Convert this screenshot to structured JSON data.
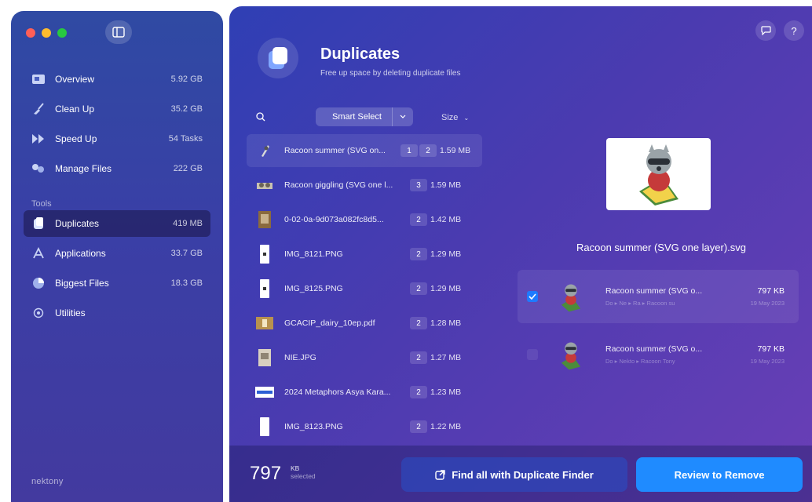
{
  "sidebar": {
    "items": [
      {
        "label": "Overview",
        "size": "5.92 GB",
        "icon": "overview-icon"
      },
      {
        "label": "Clean Up",
        "size": "35.2 GB",
        "icon": "broom-icon"
      },
      {
        "label": "Speed Up",
        "size": "54 Tasks",
        "icon": "speed-icon"
      },
      {
        "label": "Manage Files",
        "size": "222 GB",
        "icon": "files-icon"
      }
    ],
    "tools_heading": "Tools",
    "tools": [
      {
        "label": "Duplicates",
        "size": "419 MB",
        "icon": "duplicates-icon",
        "active": true
      },
      {
        "label": "Applications",
        "size": "33.7 GB",
        "icon": "applications-icon"
      },
      {
        "label": "Biggest Files",
        "size": "18.3 GB",
        "icon": "pie-icon"
      },
      {
        "label": "Utilities",
        "size": "",
        "icon": "utilities-icon"
      }
    ],
    "brand": "nektony"
  },
  "header": {
    "title": "Duplicates",
    "subtitle": "Free up space by deleting duplicate files"
  },
  "toolbar": {
    "smart_select": "Smart Select",
    "size_sort": "Size"
  },
  "files": [
    {
      "name": "Racoon summer (SVG on...",
      "badges": [
        "1",
        "2"
      ],
      "size": "1.59 MB",
      "selected": true
    },
    {
      "name": "Racoon giggling (SVG one l...",
      "badges": [
        "3"
      ],
      "size": "1.59 MB"
    },
    {
      "name": "0-02-0a-9d073a082fc8d5...",
      "badges": [
        "2"
      ],
      "size": "1.42 MB"
    },
    {
      "name": "IMG_8121.PNG",
      "badges": [
        "2"
      ],
      "size": "1.29 MB"
    },
    {
      "name": "IMG_8125.PNG",
      "badges": [
        "2"
      ],
      "size": "1.29 MB"
    },
    {
      "name": "GCACIP_dairy_10ep.pdf",
      "badges": [
        "2"
      ],
      "size": "1.28 MB"
    },
    {
      "name": "NIE.JPG",
      "badges": [
        "2"
      ],
      "size": "1.27 MB"
    },
    {
      "name": "2024 Metaphors Asya Kara...",
      "badges": [
        "2"
      ],
      "size": "1.23 MB"
    },
    {
      "name": "IMG_8123.PNG",
      "badges": [
        "2"
      ],
      "size": "1.22 MB"
    }
  ],
  "preview": {
    "filename": "Racoon summer (SVG one layer).svg",
    "duplicates": [
      {
        "name": "Racoon summer (SVG o...",
        "path": "Do ▸ Ne ▸ Ra ▸ Racoon su",
        "size": "797 KB",
        "date": "19 May 2023",
        "checked": true
      },
      {
        "name": "Racoon summer (SVG o...",
        "path": "Do ▸ Nekto ▸ Racoon Tony",
        "size": "797 KB",
        "date": "19 May 2023",
        "checked": false
      }
    ]
  },
  "footer": {
    "selected_amount": "797",
    "selected_unit": "KB",
    "selected_label": "selected",
    "find_button": "Find all with Duplicate Finder",
    "review_button": "Review to Remove"
  },
  "colors": {
    "accent": "#1f8bff",
    "checkbox": "#1e7bff"
  }
}
